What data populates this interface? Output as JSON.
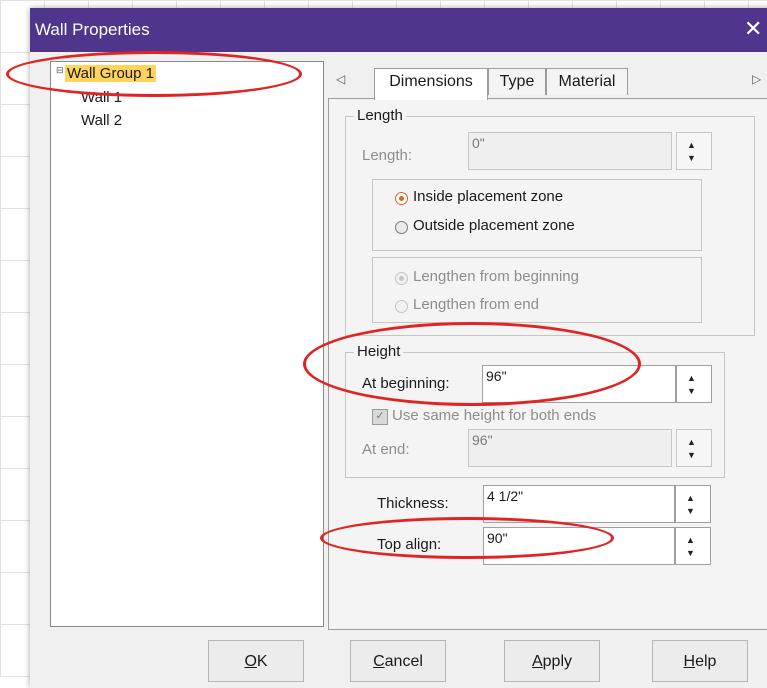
{
  "window": {
    "title": "Wall Properties"
  },
  "tree": {
    "group": "Wall Group 1",
    "items": [
      "Wall 1",
      "Wall 2"
    ]
  },
  "tabs": [
    "Dimensions",
    "Type",
    "Material"
  ],
  "length": {
    "group_label": "Length",
    "label": "Length:",
    "value": "0\"",
    "placement": [
      "Inside placement zone",
      "Outside placement zone"
    ],
    "lengthen": [
      "Lengthen from beginning",
      "Lengthen from end"
    ]
  },
  "height": {
    "group_label": "Height",
    "at_beginning_label": "At beginning:",
    "at_beginning_value": "96\"",
    "same_height_label": "Use same height for both ends",
    "at_end_label": "At end:",
    "at_end_value": "96\""
  },
  "thickness": {
    "label": "Thickness:",
    "value": "4 1/2\""
  },
  "top_align": {
    "label": "Top align:",
    "value": "90\""
  },
  "buttons": {
    "ok": {
      "mnemonic": "O",
      "rest": "K"
    },
    "cancel": {
      "mnemonic": "C",
      "rest": "ancel"
    },
    "apply": {
      "mnemonic": "A",
      "rest": "pply"
    },
    "help": {
      "mnemonic": "H",
      "rest": "elp"
    }
  },
  "colors": {
    "titlebar": "#4f358b",
    "selection": "#ffd35c",
    "annotation": "#e02323",
    "radio_selected": "#d06a2a"
  }
}
